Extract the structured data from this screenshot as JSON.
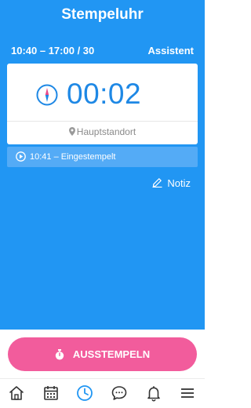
{
  "header": {
    "title": "Stempeluhr"
  },
  "shift": {
    "time_range": "10:40 – 17:00 / 30",
    "assistant_label": "Assistent"
  },
  "timer": {
    "value": "00:02",
    "location": "Hauptstandort"
  },
  "log": {
    "entry": "10:41 – Eingestempelt"
  },
  "note": {
    "label": "Notiz"
  },
  "action": {
    "button_label": "AUSSTEMPELN"
  },
  "nav": {
    "items": [
      {
        "icon": "home-icon"
      },
      {
        "icon": "calendar-icon"
      },
      {
        "icon": "clock-icon",
        "active": true
      },
      {
        "icon": "chat-icon"
      },
      {
        "icon": "bell-icon"
      },
      {
        "icon": "menu-icon"
      }
    ]
  },
  "colors": {
    "primary": "#2196f3",
    "accent": "#f25c9c",
    "timer_text": "#1e88e5",
    "log_bar": "#54abf6"
  }
}
